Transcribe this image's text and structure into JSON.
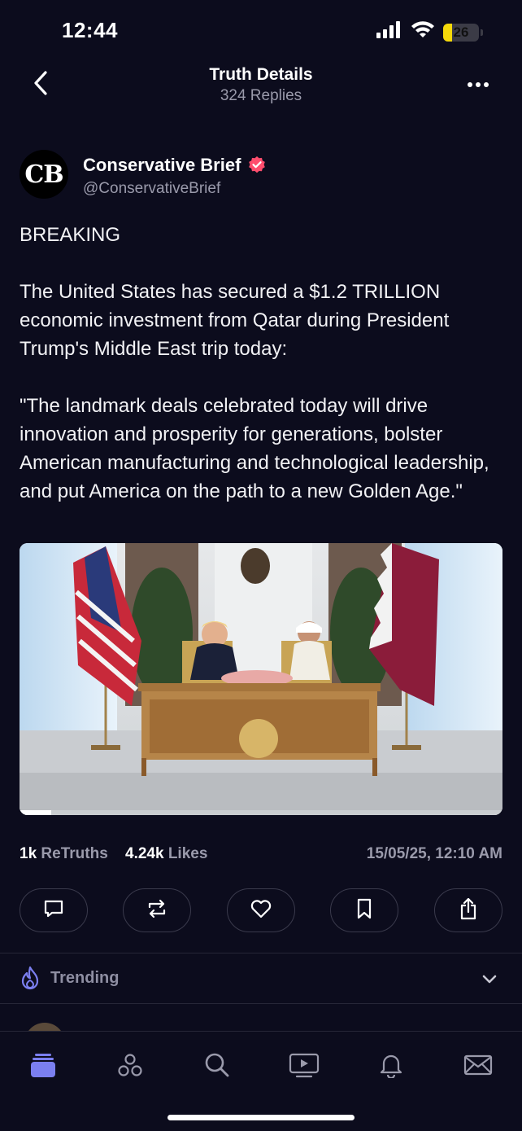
{
  "status_bar": {
    "time": "12:44",
    "battery": "26",
    "battery_level": 0.26,
    "icons": [
      "signal-icon",
      "wifi-icon",
      "battery-icon"
    ]
  },
  "header": {
    "title": "Truth Details",
    "subtitle": "324 Replies",
    "back_icon": "chevron-left-icon",
    "more_icon": "more-dots-icon"
  },
  "post": {
    "avatar_text": "CB",
    "author_name": "Conservative Brief",
    "author_handle": "@ConservativeBrief",
    "verified_icon": "verified-badge-icon",
    "text_line1": "BREAKING",
    "text_para2": "The United States has secured a $1.2 TRILLION economic investment from Qatar during President Trump's Middle East trip today:",
    "text_para3": "\"The landmark deals celebrated today will drive innovation and prosperity for generations, bolster American manufacturing and technological leadership, and put America on the path to a new Golden Age.\"",
    "video_progress": 0.065
  },
  "stats": {
    "retruths_count": "1k",
    "retruths_label": "ReTruths",
    "likes_count": "4.24k",
    "likes_label": "Likes",
    "timestamp": "15/05/25, 12:10 AM"
  },
  "actions": [
    "reply-icon",
    "retruth-icon",
    "like-icon",
    "bookmark-icon",
    "share-icon"
  ],
  "trending": {
    "label": "Trending",
    "icon": "flame-icon",
    "chevron": "chevron-down-icon"
  },
  "tabs": [
    "home-icon",
    "groups-icon",
    "search-icon",
    "video-icon",
    "bell-icon",
    "mail-icon"
  ],
  "colors": {
    "background": "#0c0c1d",
    "accent": "#7b7ff0",
    "verified": "#ff4d6d",
    "muted": "#9a9aab"
  }
}
